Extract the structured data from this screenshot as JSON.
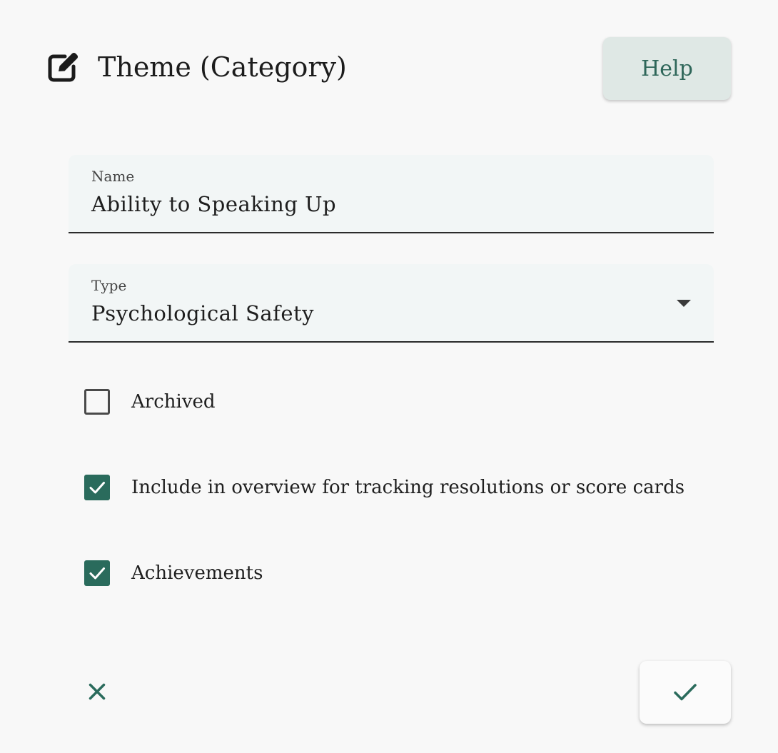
{
  "header": {
    "icon": "edit-icon",
    "title": "Theme (Category)",
    "help_label": "Help"
  },
  "fields": {
    "name": {
      "label": "Name",
      "value": "Ability to Speaking Up"
    },
    "type": {
      "label": "Type",
      "value": "Psychological Safety",
      "icon": "dropdown-arrow-icon"
    }
  },
  "checkboxes": [
    {
      "label": "Archived",
      "checked": false
    },
    {
      "label": "Include in overview for tracking resolutions or score cards",
      "checked": true
    },
    {
      "label": "Achievements",
      "checked": true
    }
  ],
  "footer": {
    "cancel_icon": "close-icon",
    "confirm_icon": "check-icon"
  },
  "colors": {
    "accent": "#2a6b5c",
    "help_button_bg": "#dfe8e5",
    "field_bg": "#f2f6f6",
    "page_bg": "#f8f8f8"
  }
}
